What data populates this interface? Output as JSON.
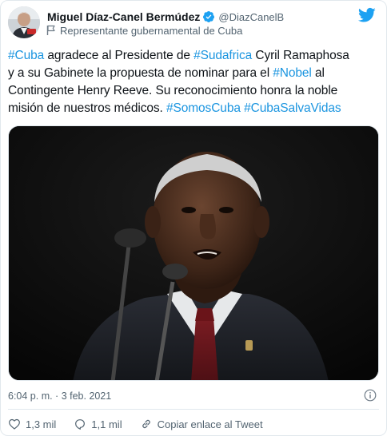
{
  "author": {
    "name": "Miguel Díaz-Canel Bermúdez",
    "handle": "@DiazCanelB",
    "label": "Representante gubernamental de Cuba"
  },
  "tweet": {
    "lines": [
      [
        {
          "text": "#Cuba",
          "tag": true
        },
        {
          "text": " agradece al Presidente de ",
          "tag": false
        },
        {
          "text": "#Sudafrica",
          "tag": true
        },
        {
          "text": " Cyril Ramaphosa",
          "tag": false
        }
      ],
      [
        {
          "text": "y a su Gabinete la propuesta de nominar para el ",
          "tag": false
        },
        {
          "text": "#Nobel",
          "tag": true
        },
        {
          "text": " al",
          "tag": false
        }
      ],
      [
        {
          "text": "Contingente Henry Reeve. Su reconocimiento honra la noble",
          "tag": false
        }
      ],
      [
        {
          "text": "misión de nuestros médicos. ",
          "tag": false
        },
        {
          "text": "#SomosCuba",
          "tag": true
        },
        {
          "text": " ",
          "tag": false
        },
        {
          "text": "#CubaSalvaVidas",
          "tag": true
        }
      ]
    ]
  },
  "meta": {
    "timestamp": "6:04 p. m. · 3 feb. 2021"
  },
  "actions": {
    "likes": "1,3 mil",
    "replies": "1,1 mil",
    "copy_link": "Copiar enlace al Tweet"
  },
  "colors": {
    "accent": "#1b95e0",
    "secondary_text": "#536471",
    "border": "#e1e8ed",
    "twitter_blue": "#1da1f2"
  },
  "icons": {
    "header": [
      "avatar",
      "verified-badge-icon",
      "flag-icon",
      "twitter-bird-icon"
    ],
    "meta": [
      "info-icon"
    ],
    "actions": [
      "heart-icon",
      "reply-icon",
      "link-icon"
    ]
  }
}
